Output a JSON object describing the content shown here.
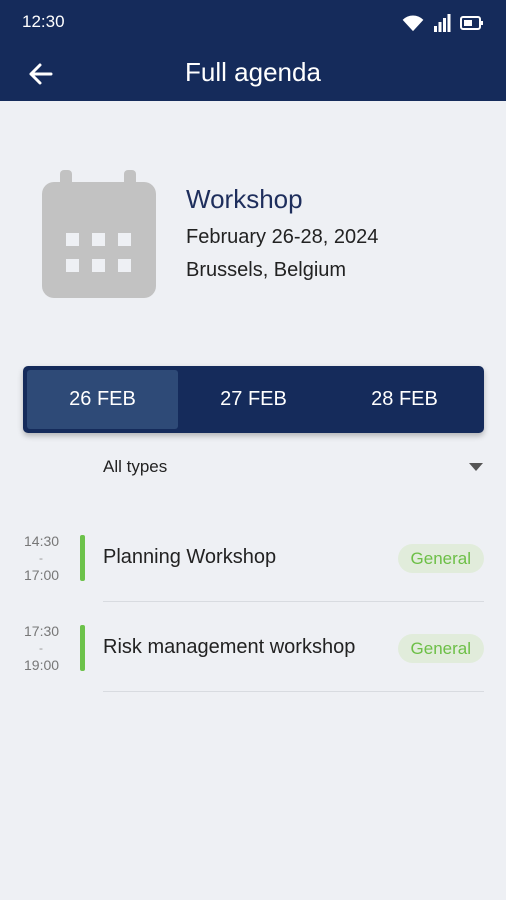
{
  "status_bar": {
    "time": "12:30"
  },
  "header": {
    "title": "Full agenda"
  },
  "event": {
    "name": "Workshop",
    "dates": "February 26-28, 2024",
    "location": "Brussels, Belgium"
  },
  "day_tabs": [
    {
      "label": "26 FEB",
      "selected": true
    },
    {
      "label": "27 FEB",
      "selected": false
    },
    {
      "label": "28 FEB",
      "selected": false
    }
  ],
  "filter": {
    "label": "All types"
  },
  "sessions": [
    {
      "start": "14:30",
      "separator": "-",
      "end": "17:00",
      "title": "Planning Workshop",
      "type": "General"
    },
    {
      "start": "17:30",
      "separator": "-",
      "end": "19:00",
      "title": "Risk management workshop",
      "type": "General"
    }
  ],
  "colors": {
    "header": "#152b5b",
    "active_tab": "#2e4a77",
    "session_accent": "#6cc24a",
    "badge_bg": "#e1ecdb",
    "badge_text": "#6cbf46",
    "background": "#eef0f4"
  }
}
